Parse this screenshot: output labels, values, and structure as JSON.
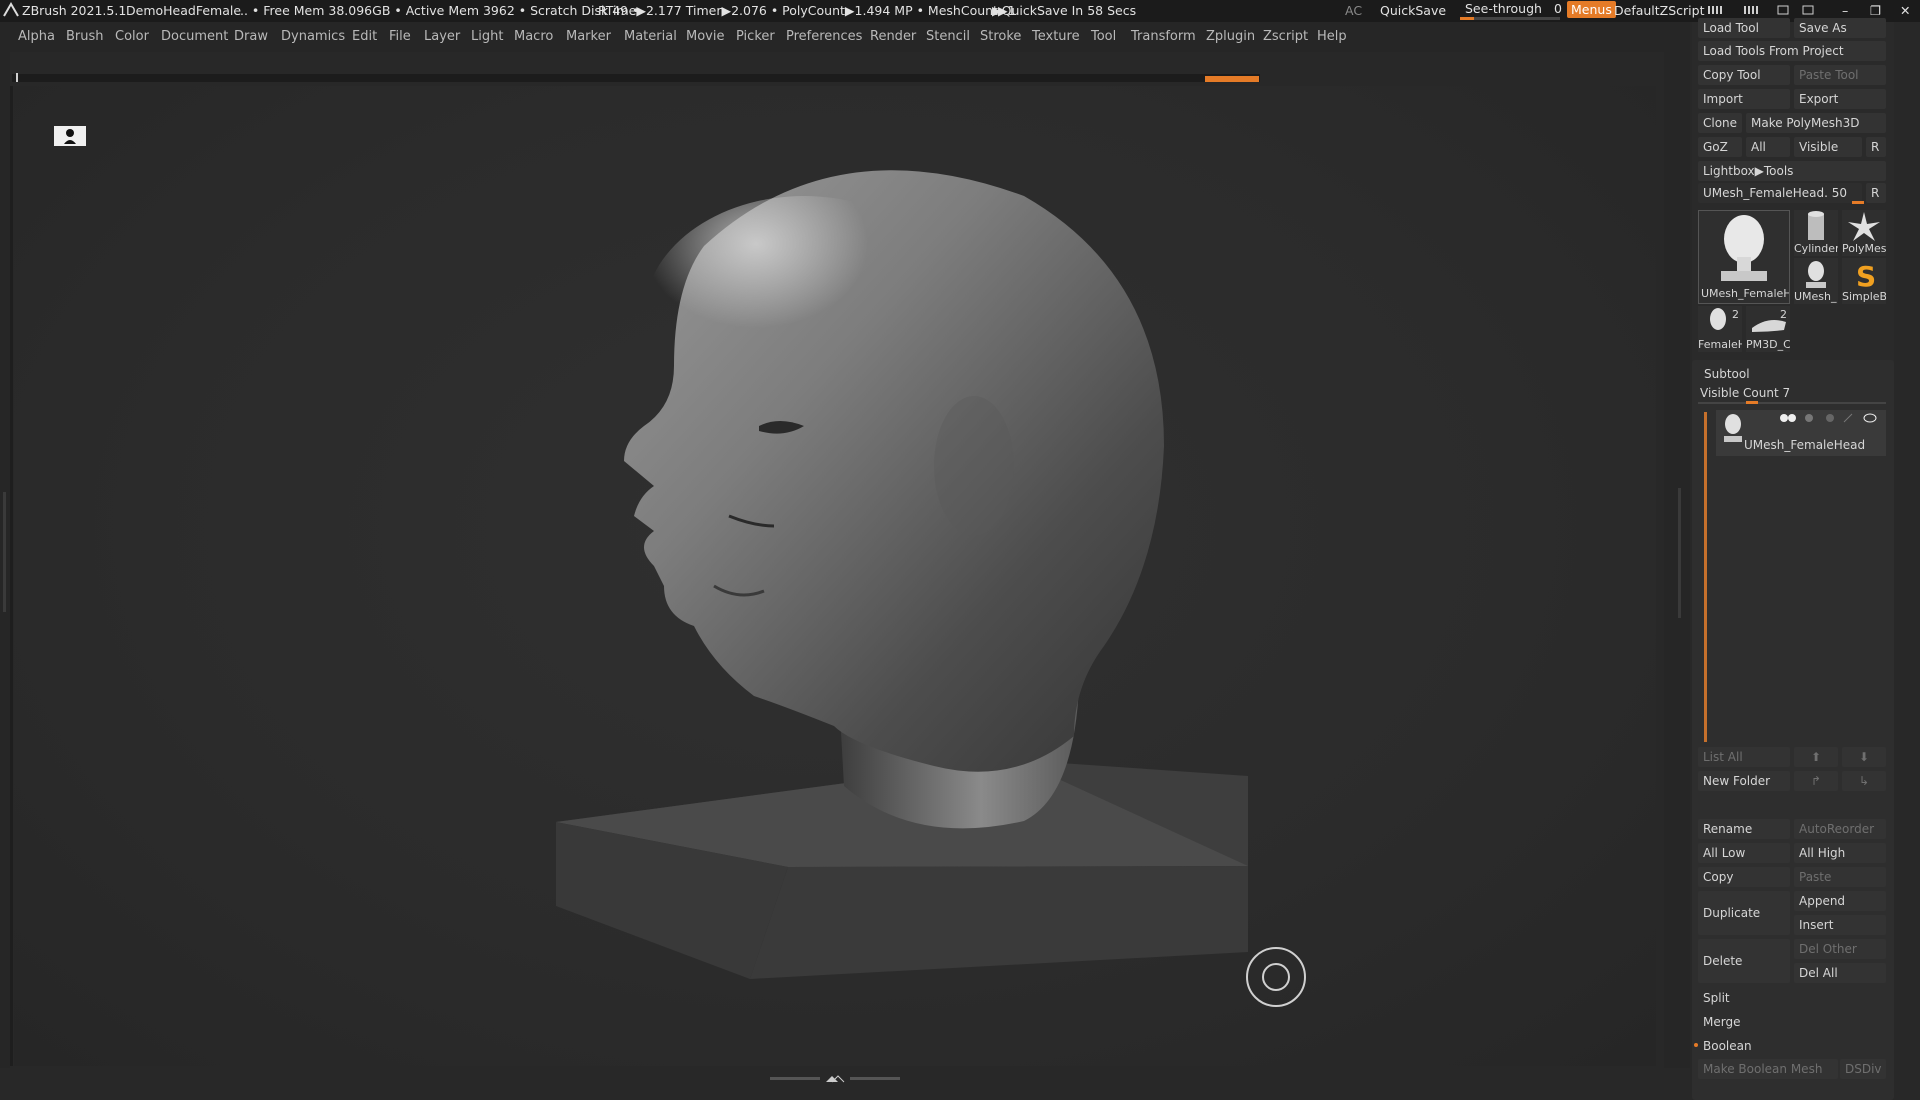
{
  "titlebar": {
    "app": "ZBrush 2021.5.1",
    "document": "DemoHeadFemale",
    "free_mem": ".. • Free Mem 38.096GB • Active Mem 3962 • Scratch Disk 49 •",
    "rtime": "RTime▶2.177 Timer▶2.076 • PolyCount▶1.494 MP • MeshCount▶1",
    "quicksave_timer": "▶QuickSave In 58 Secs",
    "ac": "AC",
    "quicksave": "QuickSave",
    "see_through": "See-through",
    "see_through_value": "0",
    "menus": "Menus",
    "default_zscript": "DefaultZScript"
  },
  "menubar": [
    "Alpha",
    "Brush",
    "Color",
    "Document",
    "Draw",
    "Dynamics",
    "Edit",
    "File",
    "Layer",
    "Light",
    "Macro",
    "Marker",
    "Material",
    "Movie",
    "Picker",
    "Preferences",
    "Render",
    "Stencil",
    "Stroke",
    "Texture",
    "Tool",
    "Transform",
    "Zplugin",
    "Zscript",
    "Help"
  ],
  "tool_panel": {
    "load_tool": "Load Tool",
    "save_as": "Save As",
    "load_from_project": "Load Tools From Project",
    "copy_tool": "Copy Tool",
    "paste_tool": "Paste Tool",
    "import": "Import",
    "export": "Export",
    "clone": "Clone",
    "make_polymesh": "Make PolyMesh3D",
    "goz": "GoZ",
    "all": "All",
    "visible": "Visible",
    "r": "R",
    "lightbox_tools": "Lightbox▶Tools",
    "current_tool": "UMesh_FemaleHead. 50",
    "thumbs": {
      "main": "UMesh_FemaleH",
      "cylinder": "Cylinder",
      "polymesh": "PolyMes",
      "umesh_small": "UMesh_",
      "simpleb": "SimpleB",
      "female": "FemaleH",
      "female_count": "2",
      "pm3d": "PM3D_C",
      "pm3d_count": "2"
    }
  },
  "subtool": {
    "title": "Subtool",
    "visible_count": "Visible Count 7",
    "item_name": "UMesh_FemaleHead",
    "list_all": "List All",
    "new_folder": "New Folder",
    "rename": "Rename",
    "auto_reorder": "AutoReorder",
    "all_low": "All Low",
    "all_high": "All High",
    "copy": "Copy",
    "paste": "Paste",
    "duplicate": "Duplicate",
    "append": "Append",
    "insert": "Insert",
    "delete": "Delete",
    "del_other": "Del Other",
    "del_all": "Del All",
    "split": "Split",
    "merge": "Merge",
    "boolean": "Boolean",
    "make_boolean_mesh": "Make Boolean Mesh",
    "dsdiv": "DSDiv"
  },
  "colors": {
    "accent": "#e57b27",
    "background": "#282828",
    "panel": "#2a2a2a"
  }
}
